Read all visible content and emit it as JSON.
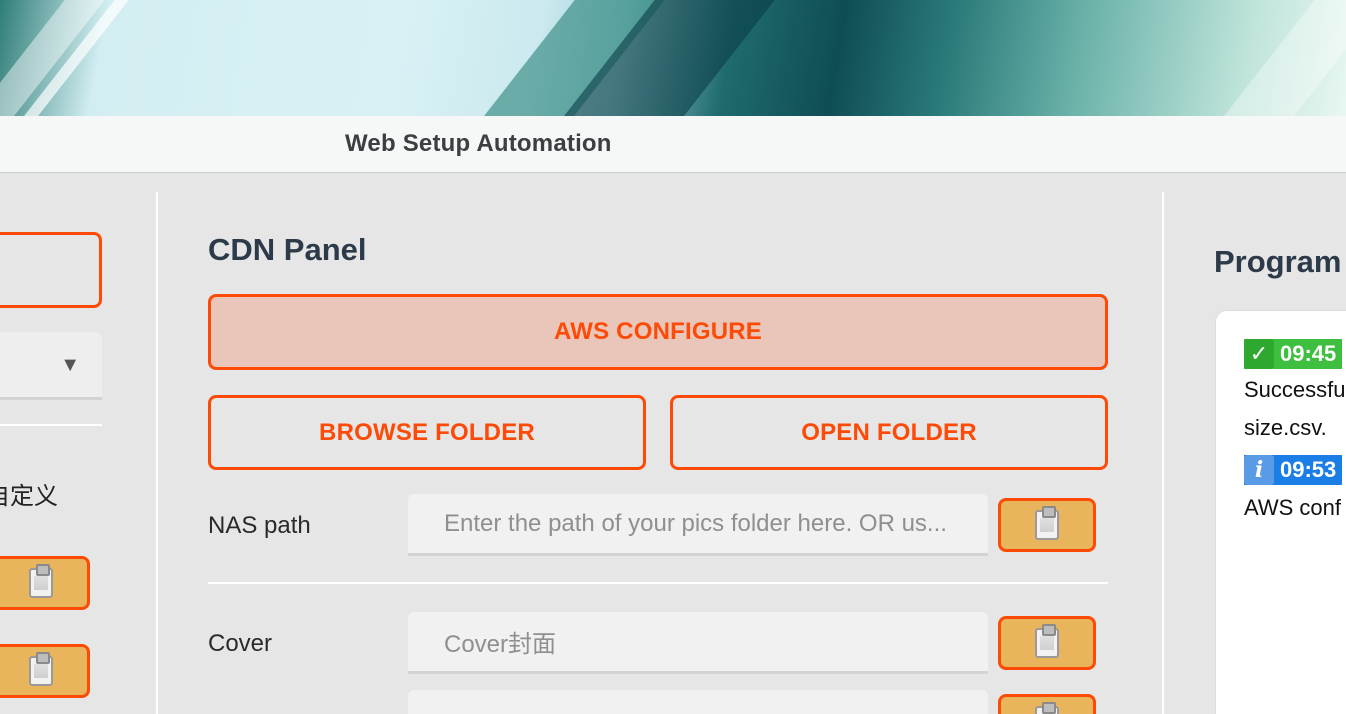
{
  "window": {
    "title": "Web Setup Automation"
  },
  "left_panel": {
    "text_fragment": "自定义",
    "select_arrow": "▼"
  },
  "cdn_panel": {
    "title": "CDN Panel",
    "aws_configure_label": "AWS CONFIGURE",
    "browse_folder_label": "BROWSE FOLDER",
    "open_folder_label": "OPEN FOLDER",
    "nas_path": {
      "label": "NAS path",
      "placeholder": "Enter the path of your pics folder here. OR us..."
    },
    "cover": {
      "label": "Cover",
      "placeholder": "Cover封面"
    }
  },
  "log_panel": {
    "title": "Program",
    "entries": [
      {
        "icon": "✓",
        "time": "09:45",
        "lines": [
          "Successfu",
          "size.csv."
        ],
        "status_color": "#3fbf3f"
      },
      {
        "icon": "i",
        "time": "09:53",
        "lines": [
          "AWS conf"
        ],
        "status_color": "#1a7ee6"
      }
    ]
  },
  "colors": {
    "accent": "#fd4b07",
    "clipboard_button": "#e8b45c",
    "aws_button_bg": "#eac5b9"
  },
  "icons": {
    "clipboard": "clipboard-icon",
    "dropdown": "chevron-down-icon"
  }
}
